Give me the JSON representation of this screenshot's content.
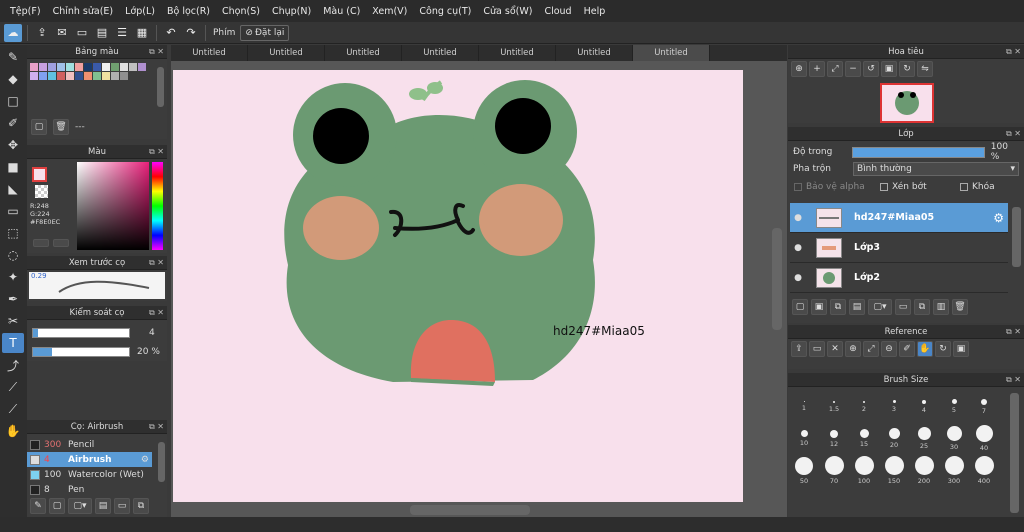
{
  "menu": [
    "Tệp(F)",
    "Chỉnh sửa(E)",
    "Lớp(L)",
    "Bộ lọc(R)",
    "Chọn(S)",
    "Chụp(N)",
    "Màu (C)",
    "Xem(V)",
    "Công cụ(T)",
    "Cửa sổ(W)",
    "Cloud",
    "Help"
  ],
  "toolbar": {
    "phim_label": "Phím",
    "reset_label": "Đặt lại"
  },
  "tabs": [
    "Untitled",
    "Untitled",
    "Untitled",
    "Untitled",
    "Untitled",
    "Untitled",
    "Untitled"
  ],
  "palette": {
    "title": "Bảng màu",
    "footer": "---",
    "colors": [
      "#e8a0c8",
      "#c8a0e0",
      "#a0a0e0",
      "#a0c0e8",
      "#a0e0e0",
      "#f0a0a0",
      "#1a3a6a",
      "#3a5aaa",
      "#f0f0f0",
      "#70a070",
      "#e0e0e0",
      "#c0c0c0",
      "#b090d0",
      "#d0b0f0",
      "#80a0f0",
      "#60c0e0",
      "#d06060",
      "#f0c0c0",
      "#305090",
      "#f09070",
      "#80c090",
      "#f0e0a0",
      "#b0b0b0",
      "#909090"
    ]
  },
  "color": {
    "title": "Màu",
    "r": "R:248",
    "g": "G:224",
    "hex": "#F8E0EC",
    "swatch": "#F8E0EC"
  },
  "preview": {
    "title": "Xem trước cọ",
    "size": "0.29"
  },
  "brush_control": {
    "title": "Kiểm soát cọ",
    "size_value": "4",
    "opacity_value": "20 %"
  },
  "brush_list": {
    "title": "Cọ: Airbrush",
    "items": [
      {
        "size": "300",
        "name": "Pencil"
      },
      {
        "size": "4",
        "name": "Airbrush"
      },
      {
        "size": "100",
        "name": "Watercolor (Wet)"
      },
      {
        "size": "8",
        "name": "Pen"
      }
    ]
  },
  "canvas": {
    "bg": "#f8e0ec",
    "signature": "hd247#Miaa05"
  },
  "navigator": {
    "title": "Hoa tiêu"
  },
  "layers": {
    "title": "Lớp",
    "opacity_label": "Độ trong",
    "opacity_value": "100 %",
    "blend_label": "Pha trộn",
    "blend_value": "Bình thường",
    "protect_label": "Bảo vệ alpha",
    "clip_label": "Xén bớt",
    "lock_label": "Khóa",
    "items": [
      "hd247#Miaa05",
      "Lớp3",
      "Lớp2"
    ]
  },
  "reference": {
    "title": "Reference"
  },
  "brush_size": {
    "title": "Brush Size",
    "sizes": [
      "1",
      "1.5",
      "2",
      "3",
      "4",
      "5",
      "7",
      "10",
      "12",
      "15",
      "20",
      "25",
      "30",
      "40",
      "50",
      "70",
      "100",
      "150",
      "200",
      "300",
      "400"
    ]
  }
}
